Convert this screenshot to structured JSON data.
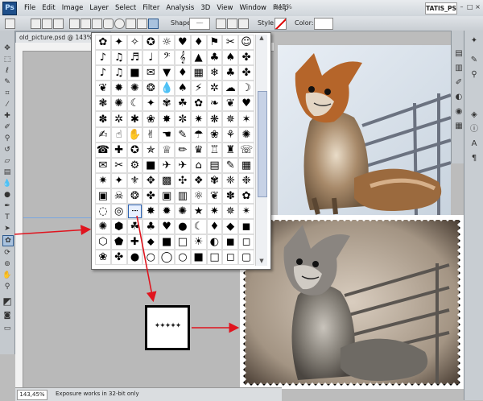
{
  "app": {
    "logo": "Ps",
    "menu": [
      "File",
      "Edit",
      "Image",
      "Layer",
      "Select",
      "Filter",
      "Analysis",
      "3D",
      "View",
      "Window",
      "Help"
    ],
    "zoom_menu": "143%",
    "workspace": "TATIS_PS"
  },
  "options_bar": {
    "shape_label": "Shape:",
    "style_label": "Style:",
    "color_label": "Color:"
  },
  "document": {
    "tab_title": "old_picture.psd @ 143% (l",
    "status_zoom": "143,45%",
    "status_message": "Exposure works in 32-bit only"
  },
  "shape_picker": {
    "rows": [
      [
        "✿",
        "✦",
        "✧",
        "✪",
        "☼",
        "♥",
        "♦",
        "⚑",
        "✂",
        "☺"
      ],
      [
        "♪",
        "♫",
        "♬",
        "♩",
        "𝄢",
        "𝄞",
        "▲",
        "♣",
        "♠",
        "✤"
      ],
      [
        "♪",
        "♫",
        "■",
        "✉",
        "▼",
        "♦",
        "▦",
        "❄",
        "♣",
        "✤"
      ],
      [
        "❦",
        "✹",
        "✺",
        "❂",
        "💧",
        "♠",
        "⚡",
        "✲",
        "☁",
        "☽"
      ],
      [
        "❃",
        "✺",
        "☾",
        "✦",
        "✾",
        "☘",
        "✿",
        "❧",
        "❦",
        "♥"
      ],
      [
        "✽",
        "✲",
        "✱",
        "❀",
        "✸",
        "✼",
        "✷",
        "❋",
        "✵",
        "✶"
      ],
      [
        "✍",
        "☝",
        "✋",
        "✌",
        "☚",
        "✎",
        "☂",
        "❀",
        "⚘",
        "✺"
      ],
      [
        "☎",
        "✚",
        "✪",
        "✯",
        "♕",
        "✏",
        "♛",
        "♖",
        "♜",
        "☏"
      ],
      [
        "✉",
        "✂",
        "⚙",
        "■",
        "✈",
        "✈",
        "⌂",
        "▤",
        "✎",
        "▦"
      ],
      [
        "✷",
        "✦",
        "⚜",
        "✥",
        "▩",
        "✣",
        "❖",
        "✾",
        "❈",
        "❉"
      ],
      [
        "▣",
        "☠",
        "❂",
        "✤",
        "▣",
        "▥",
        "⚛",
        "❦",
        "✽",
        "✿"
      ],
      [
        "◌",
        "◎",
        "┈",
        "✸",
        "✹",
        "✺",
        "★",
        "✷",
        "✵",
        "✴"
      ],
      [
        "✺",
        "⬢",
        "☘",
        "♣",
        "♥",
        "●",
        "☾",
        "♦",
        "◆",
        "◼"
      ],
      [
        "⬡",
        "⬟",
        "✚",
        "⬥",
        "■",
        "□",
        "☀",
        "◐",
        "◼",
        "◻"
      ],
      [
        "❀",
        "✤",
        "●",
        "○",
        "◯",
        "○",
        "■",
        "□",
        "◻",
        "▢"
      ]
    ],
    "selected_row": 11,
    "selected_col": 2,
    "result_shape_glyphs": "✦✦✦✦✦"
  },
  "colors": {
    "arrow": "#e0141e",
    "menu_bg": "#dde1e5",
    "canvas_bg": "#b9b9b9",
    "selection": "#2c63b3"
  },
  "icons": {
    "tools": [
      "move-icon",
      "marquee-icon",
      "lasso-icon",
      "quick-select-icon",
      "crop-icon",
      "eyedropper-icon",
      "healing-brush-icon",
      "brush-icon",
      "clone-stamp-icon",
      "history-brush-icon",
      "eraser-icon",
      "gradient-icon",
      "blur-icon",
      "dodge-icon",
      "pen-icon",
      "type-icon",
      "path-select-icon",
      "custom-shape-icon",
      "3d-rotate-icon",
      "3d-orbit-icon",
      "hand-icon",
      "zoom-icon",
      "color-swatch-icon",
      "quick-mask-icon",
      "screen-mode-icon"
    ],
    "panels": [
      "layers-icon",
      "channels-icon",
      "paths-icon",
      "adjustments-icon",
      "masks-icon",
      "swatches-icon",
      "styles-icon",
      "brush-panel-icon",
      "clone-source-icon",
      "character-icon",
      "paragraph-icon"
    ]
  }
}
